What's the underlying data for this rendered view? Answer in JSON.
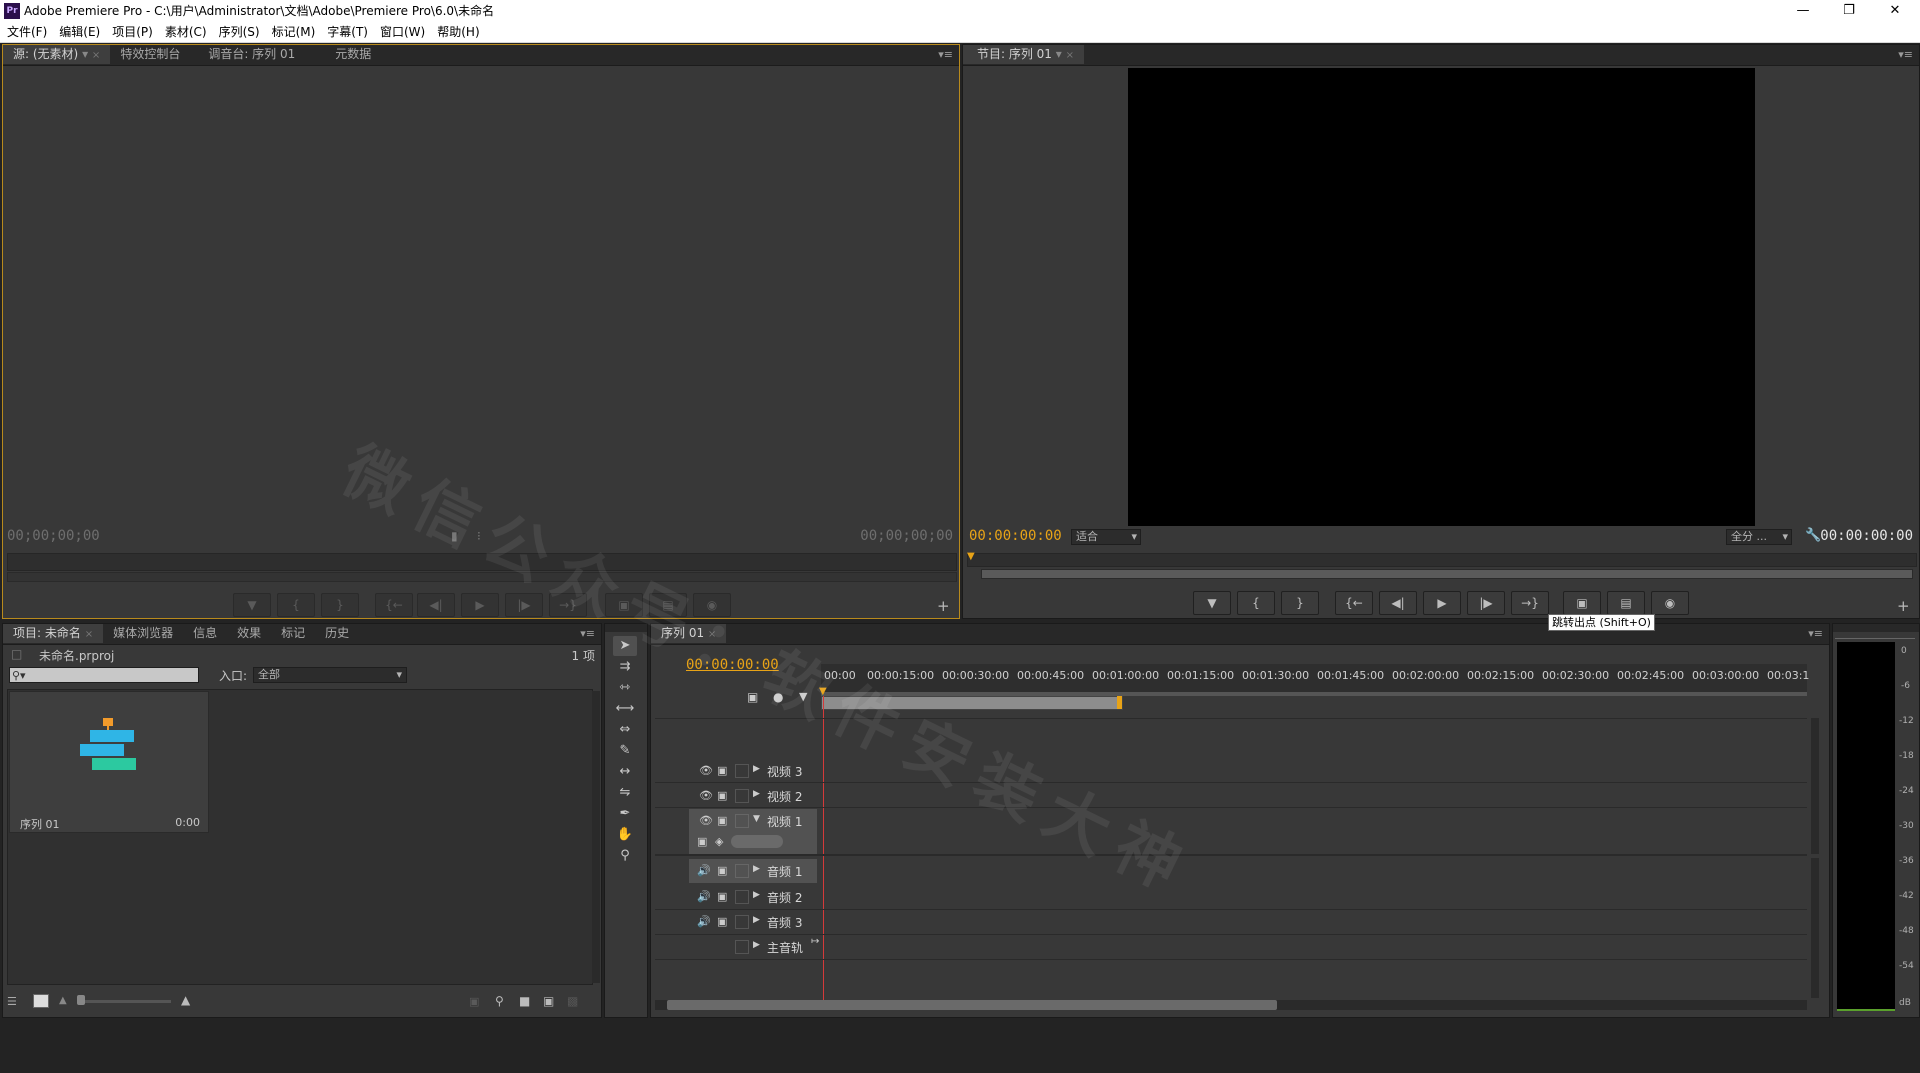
{
  "window": {
    "title": "Adobe Premiere Pro - C:\\用户\\Administrator\\文档\\Adobe\\Premiere Pro\\6.0\\未命名",
    "app_icon": "Pr"
  },
  "menu": [
    "文件(F)",
    "编辑(E)",
    "项目(P)",
    "素材(C)",
    "序列(S)",
    "标记(M)",
    "字幕(T)",
    "窗口(W)",
    "帮助(H)"
  ],
  "source_panel": {
    "tabs": [
      "源: (无素材)",
      "特效控制台",
      "调音台: 序列 01",
      "元数据"
    ],
    "timecode_in": "00;00;00;00",
    "timecode_out": "00;00;00;00"
  },
  "program_panel": {
    "tabs": [
      "节目: 序列 01"
    ],
    "timecode": "00:00:00:00",
    "fit_label": "适合",
    "full_label": "全分 ...",
    "timecode_right": "00:00:00:00",
    "tooltip": "跳转出点 (Shift+O)"
  },
  "project_panel": {
    "tabs": [
      "项目: 未命名",
      "媒体浏览器",
      "信息",
      "效果",
      "标记",
      "历史"
    ],
    "file": "未命名.prproj",
    "count": "1 项",
    "entry_label": "入口:",
    "entry_value": "全部",
    "item_name": "序列 01",
    "item_duration": "0:00"
  },
  "timeline": {
    "tab": "序列 01",
    "timecode": "00:00:00:00",
    "ruler": [
      "00:00",
      "00:00:15:00",
      "00:00:30:00",
      "00:00:45:00",
      "00:01:00:00",
      "00:01:15:00",
      "00:01:30:00",
      "00:01:45:00",
      "00:02:00:00",
      "00:02:15:00",
      "00:02:30:00",
      "00:02:45:00",
      "00:03:00:00",
      "00:03:1"
    ],
    "tracks": {
      "v3": "视频 3",
      "v2": "视频 2",
      "v1": "视频 1",
      "a1": "音频 1",
      "a2": "音频 2",
      "a3": "音频 3",
      "master": "主音轨"
    }
  },
  "audio_meter": {
    "labels": [
      "0",
      "-6",
      "-12",
      "-18",
      "-24",
      "-30",
      "-36",
      "-42",
      "-48",
      "-54",
      "dB"
    ]
  },
  "watermark": "微信公众号：软件安装大神"
}
